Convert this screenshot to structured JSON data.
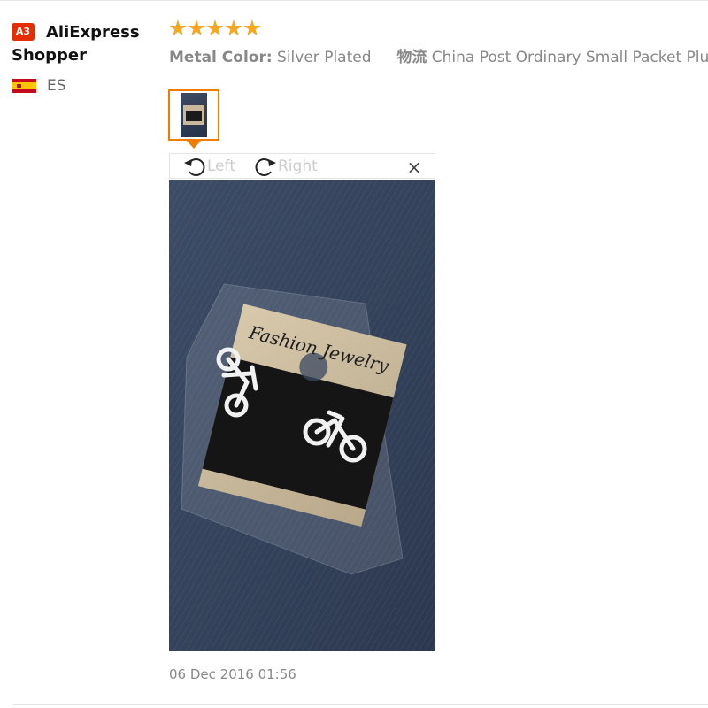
{
  "buyer": {
    "avatar_badge": "A3",
    "name": "AliExpress Shopper",
    "country_code": "ES",
    "flag_icon": "spain-flag-icon"
  },
  "review": {
    "rating": 5,
    "rating_max": 5,
    "star_color": "#f5a623",
    "attributes": [
      {
        "key": "Metal Color:",
        "value": "Silver Plated"
      },
      {
        "key": "物流",
        "value": "China Post Ordinary Small Packet Plus"
      }
    ],
    "timestamp": "06 Dec 2016 01:56"
  },
  "viewer": {
    "rotate_left_label": "Left",
    "rotate_right_label": "Right",
    "close_label": "×",
    "photo_card_text": "Fashion Jewelry"
  },
  "colors": {
    "accent": "#f07c00",
    "badge": "#e62e04"
  }
}
